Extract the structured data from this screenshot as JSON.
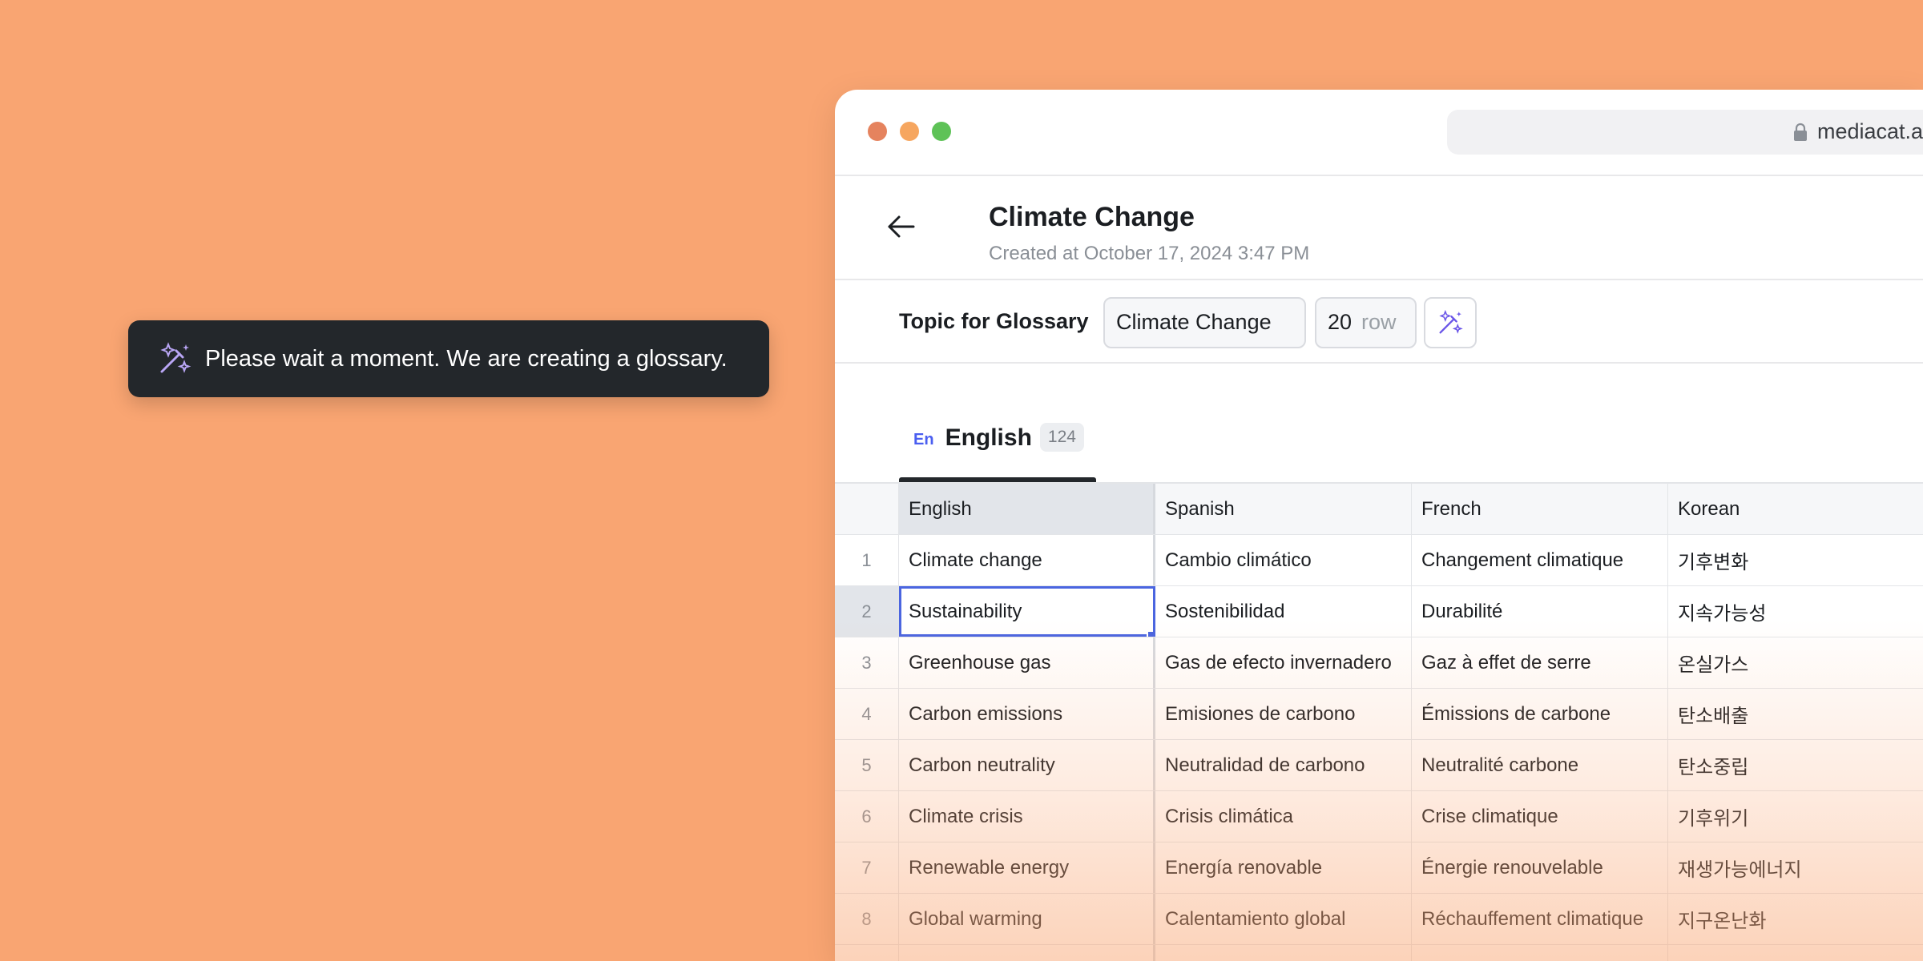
{
  "toast": {
    "message": "Please wait a moment. We are creating a glossary.",
    "icon": "magic-wand-icon"
  },
  "browser": {
    "url": "mediacat.a"
  },
  "header": {
    "title": "Climate Change",
    "subtitle": "Created at October 17, 2024 3:47 PM"
  },
  "toolbar": {
    "topic_label": "Topic for Glossary",
    "topic_value": "Climate Change",
    "row_count": "20",
    "row_unit": "row"
  },
  "tab": {
    "code": "En",
    "label": "English",
    "count": "124"
  },
  "grid": {
    "headers": [
      "English",
      "Spanish",
      "French",
      "Korean"
    ],
    "rows": [
      {
        "n": "1",
        "en": "Climate change",
        "es": "Cambio climático",
        "fr": "Changement climatique",
        "ko": "기후변화"
      },
      {
        "n": "2",
        "en": "Sustainability",
        "es": "Sostenibilidad",
        "fr": "Durabilité",
        "ko": "지속가능성"
      },
      {
        "n": "3",
        "en": "Greenhouse gas",
        "es": "Gas de efecto invernadero",
        "fr": "Gaz à effet de serre",
        "ko": "온실가스"
      },
      {
        "n": "4",
        "en": "Carbon emissions",
        "es": "Emisiones de carbono",
        "fr": "Émissions de carbone",
        "ko": "탄소배출"
      },
      {
        "n": "5",
        "en": "Carbon neutrality",
        "es": "Neutralidad de carbono",
        "fr": "Neutralité carbone",
        "ko": "탄소중립"
      },
      {
        "n": "6",
        "en": "Climate crisis",
        "es": "Crisis climática",
        "fr": "Crise climatique",
        "ko": "기후위기"
      },
      {
        "n": "7",
        "en": "Renewable energy",
        "es": "Energía renovable",
        "fr": "Énergie renouvelable",
        "ko": "재생가능에너지"
      },
      {
        "n": "8",
        "en": "Global warming",
        "es": "Calentamiento global",
        "fr": "Réchauffement climatique",
        "ko": "지구온난화"
      }
    ]
  }
}
